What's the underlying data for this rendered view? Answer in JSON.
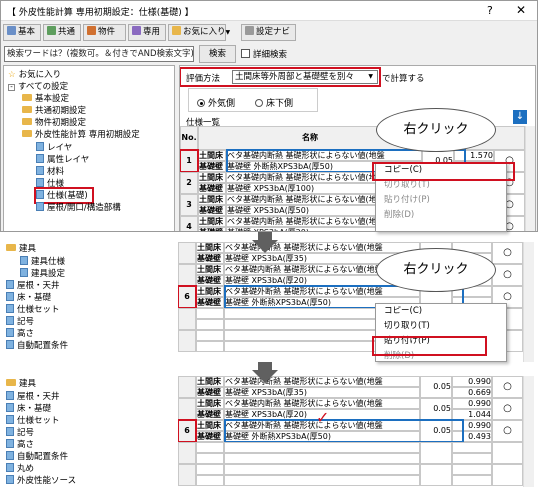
{
  "window": {
    "title": "【 外皮性能計算 専用初期設定：仕様(基礎) 】",
    "help": "?",
    "close": "✕"
  },
  "toolbar": {
    "items": [
      "基本",
      "共通",
      "物件",
      "専用",
      "お気に入り",
      "設定ナビ"
    ],
    "dropdown_marker": "▼"
  },
  "search": {
    "placeholder": "検索ワードは？(複数可。＆付きでAND検索文字)",
    "button": "検索",
    "detail_label": "詳細検索"
  },
  "tree1": {
    "items": [
      {
        "label": "お気に入り",
        "kind": "star",
        "indent": 0
      },
      {
        "label": "すべての設定",
        "kind": "exp",
        "indent": 0
      },
      {
        "label": "基本設定",
        "kind": "fold",
        "indent": 1
      },
      {
        "label": "共通初期設定",
        "kind": "fold",
        "indent": 1
      },
      {
        "label": "物件初期設定",
        "kind": "fold",
        "indent": 1
      },
      {
        "label": "外皮性能計算 専用初期設定",
        "kind": "fold",
        "indent": 1
      },
      {
        "label": "レイヤ",
        "kind": "doc",
        "indent": 2
      },
      {
        "label": "属性レイヤ",
        "kind": "doc",
        "indent": 2
      },
      {
        "label": "材料",
        "kind": "doc",
        "indent": 2
      },
      {
        "label": "仕様",
        "kind": "doc",
        "indent": 2
      },
      {
        "label": "仕様(基礎)",
        "kind": "doc",
        "indent": 2
      },
      {
        "label": "屋根/開口/構造部構",
        "kind": "doc",
        "indent": 2
      }
    ]
  },
  "tree2": {
    "items": [
      {
        "label": "建具",
        "kind": "fold",
        "indent": 0
      },
      {
        "label": "建具仕様",
        "kind": "doc",
        "indent": 1
      },
      {
        "label": "建具設定",
        "kind": "doc",
        "indent": 1
      },
      {
        "label": "屋根・天井",
        "kind": "doc",
        "indent": 0
      },
      {
        "label": "床・基礎",
        "kind": "doc",
        "indent": 0
      },
      {
        "label": "仕様セット",
        "kind": "doc",
        "indent": 0
      },
      {
        "label": "記号",
        "kind": "doc",
        "indent": 0
      },
      {
        "label": "高さ",
        "kind": "doc",
        "indent": 0
      },
      {
        "label": "自動配置条件",
        "kind": "doc",
        "indent": 0
      }
    ]
  },
  "tree3": {
    "items": [
      {
        "label": "建具",
        "kind": "fold",
        "indent": 0
      },
      {
        "label": "屋根・天井",
        "kind": "doc",
        "indent": 0
      },
      {
        "label": "床・基礎",
        "kind": "doc",
        "indent": 0
      },
      {
        "label": "仕様セット",
        "kind": "doc",
        "indent": 0
      },
      {
        "label": "記号",
        "kind": "doc",
        "indent": 0
      },
      {
        "label": "高さ",
        "kind": "doc",
        "indent": 0
      },
      {
        "label": "自動配置条件",
        "kind": "doc",
        "indent": 0
      },
      {
        "label": "丸め",
        "kind": "doc",
        "indent": 0
      },
      {
        "label": "外皮性能ソース",
        "kind": "doc",
        "indent": 0
      }
    ]
  },
  "eval": {
    "label": "評価方法",
    "value": "土間床等外周部と基礎壁を別々",
    "suffix": "で計算する",
    "radio_outer": "外気側",
    "radio_under": "床下側"
  },
  "list": {
    "title": "仕様一覧",
    "col_no": "No.",
    "col_name": "名称"
  },
  "rows1": [
    {
      "no": "1",
      "a": "土間床",
      "b": "基礎壁",
      "n1": "ベタ基礎内断熱 基礎形状によらない値(地盤",
      "n2": "基礎壁 外断熱XPS3bA(厚50)",
      "v1": "0.05",
      "v2": "1.570",
      "v3": ""
    },
    {
      "no": "2",
      "a": "土間床",
      "b": "基礎壁",
      "n1": "ベタ基礎内断熱 基礎形状によらない値(地盤",
      "n2": "基礎壁 XPS3bA(厚100)",
      "v1": "",
      "v2": "",
      "v3": ""
    },
    {
      "no": "3",
      "a": "土間床",
      "b": "基礎壁",
      "n1": "ベタ基礎内断熱 基礎形状によらない値(地盤",
      "n2": "基礎壁 XPS3bA(厚50)",
      "v1": "",
      "v2": "",
      "v3": ""
    },
    {
      "no": "4",
      "a": "土間床",
      "b": "基礎壁",
      "n1": "ベタ基礎内断熱 基礎形状によらない値(地盤",
      "n2": "基礎壁 XPS3bA(厚20)",
      "v1": "",
      "v2": "",
      "v3": ""
    }
  ],
  "rows2": [
    {
      "no": "",
      "a": "土間床",
      "b": "基礎壁",
      "n1": "ベタ基礎内断熱 基礎形状によらない値(地盤",
      "n2": "基礎壁 XPS3bA(厚35)"
    },
    {
      "no": "",
      "a": "土間床",
      "b": "基礎壁",
      "n1": "ベタ基礎内断熱 基礎形状によらない値(地盤",
      "n2": "基礎壁 XPS3bA(厚20)"
    },
    {
      "no": "6",
      "a": "土間床",
      "b": "基礎壁",
      "n1": "ベタ基礎外断熱 基礎形状によらない値(地盤",
      "n2": "基礎壁 外断熱XPS3bA(厚50)"
    },
    {
      "no": "",
      "a": "",
      "b": "",
      "n1": "",
      "n2": ""
    },
    {
      "no": "",
      "a": "",
      "b": "",
      "n1": "",
      "n2": ""
    }
  ],
  "rows3": [
    {
      "no": "",
      "a": "土間床",
      "b": "基礎壁",
      "n1": "ベタ基礎内断熱 基礎形状によらない値(地盤",
      "n2": "基礎壁 XPS3bA(厚35)",
      "v1": "0.05",
      "v2": "0.990",
      "v3": "0.669"
    },
    {
      "no": "",
      "a": "土間床",
      "b": "基礎壁",
      "n1": "ベタ基礎内断熱 基礎形状によらない値(地盤",
      "n2": "基礎壁 XPS3bA(厚20)",
      "v1": "0.05",
      "v2": "0.990",
      "v3": "1.044"
    },
    {
      "no": "6",
      "a": "土間床",
      "b": "基礎壁",
      "n1": "ベタ基礎外断熱 基礎形状によらない値(地盤",
      "n2": "基礎壁 外断熱XPS3bA(厚50)",
      "v1": "0.05",
      "v2": "0.990",
      "v3": "0.493"
    },
    {
      "no": "",
      "a": "",
      "b": "",
      "n1": "",
      "n2": "",
      "v1": "",
      "v2": "",
      "v3": ""
    },
    {
      "no": "",
      "a": "",
      "b": "",
      "n1": "",
      "n2": "",
      "v1": "",
      "v2": "",
      "v3": ""
    }
  ],
  "ctx1": {
    "items": [
      "コピー(C)",
      "切り取り(T)",
      "貼り付け(P)",
      "削除(D)"
    ]
  },
  "ctx2": {
    "items": [
      "コピー(C)",
      "切り取り(T)",
      "貼り付け(P)",
      "削除(D)"
    ]
  },
  "callout": {
    "text": "右クリック"
  },
  "circle": "○",
  "colors": {
    "red": "#d01020",
    "blue": "#1c6fc0",
    "folder": "#e8b64a"
  }
}
